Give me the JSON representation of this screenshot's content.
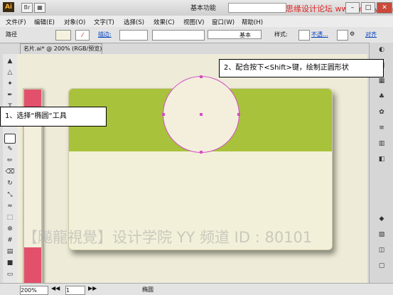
{
  "app": {
    "logo": "Ai",
    "workspace": "基本功能",
    "watermark_top": "思缘设计论坛 www.missyuan.com"
  },
  "menu": [
    "文件(F)",
    "编辑(E)",
    "对象(O)",
    "文字(T)",
    "选择(S)",
    "效果(C)",
    "视图(V)",
    "窗口(W)",
    "帮助(H)"
  ],
  "control": {
    "mode": "路径",
    "stroke_label": "描边:",
    "brush_label": "基本",
    "style_label": "样式:",
    "opacity_label": "不透...",
    "align_label": "对齐"
  },
  "document": {
    "tab_title": "名片.ai* @ 200% (RGB/预览)",
    "zoom": "200%",
    "page": "1",
    "status_tool": "椭圆",
    "canvas_overlay_text": "【飚龍視覺】设计学院  YY 频道 ID : 80101"
  },
  "callouts": {
    "step1": "1、选择“椭圆“工具",
    "step2": "2、配合按下<Shift>键，绘制正圆形状"
  },
  "colors": {
    "canvas": "#eeecd8",
    "card_green": "#a8c23b",
    "pink": "#e2506c",
    "selection": "#d24fc6"
  }
}
